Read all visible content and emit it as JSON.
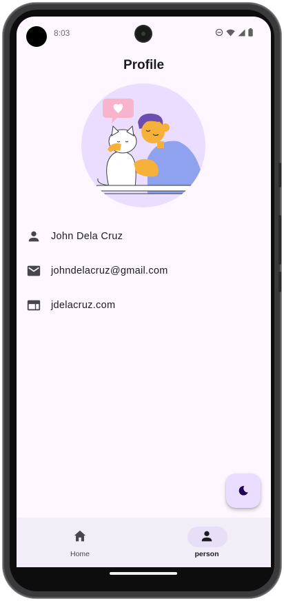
{
  "status_bar": {
    "time": "8:03",
    "icons": [
      "do-not-disturb-icon",
      "wifi-icon",
      "cellular-signal-icon",
      "battery-icon"
    ]
  },
  "page": {
    "title": "Profile"
  },
  "profile": {
    "avatar_illustration": "person-hugging-cat-with-heart-illustration",
    "name": "John Dela Cruz",
    "email": "johndelacruz@gmail.com",
    "website": "jdelacruz.com"
  },
  "fab": {
    "icon": "moon-icon"
  },
  "bottom_nav": {
    "items": [
      {
        "label": "Home",
        "icon": "home-icon",
        "selected": false
      },
      {
        "label": "person",
        "icon": "person-icon",
        "selected": true
      }
    ]
  },
  "colors": {
    "background": "#fef7ff",
    "avatar_bg": "#eaddff",
    "fab_bg": "#eaddff",
    "nav_bg": "#f3edf7",
    "nav_indicator": "#e8def8",
    "icon": "#49454f",
    "text": "#1d1b20"
  }
}
